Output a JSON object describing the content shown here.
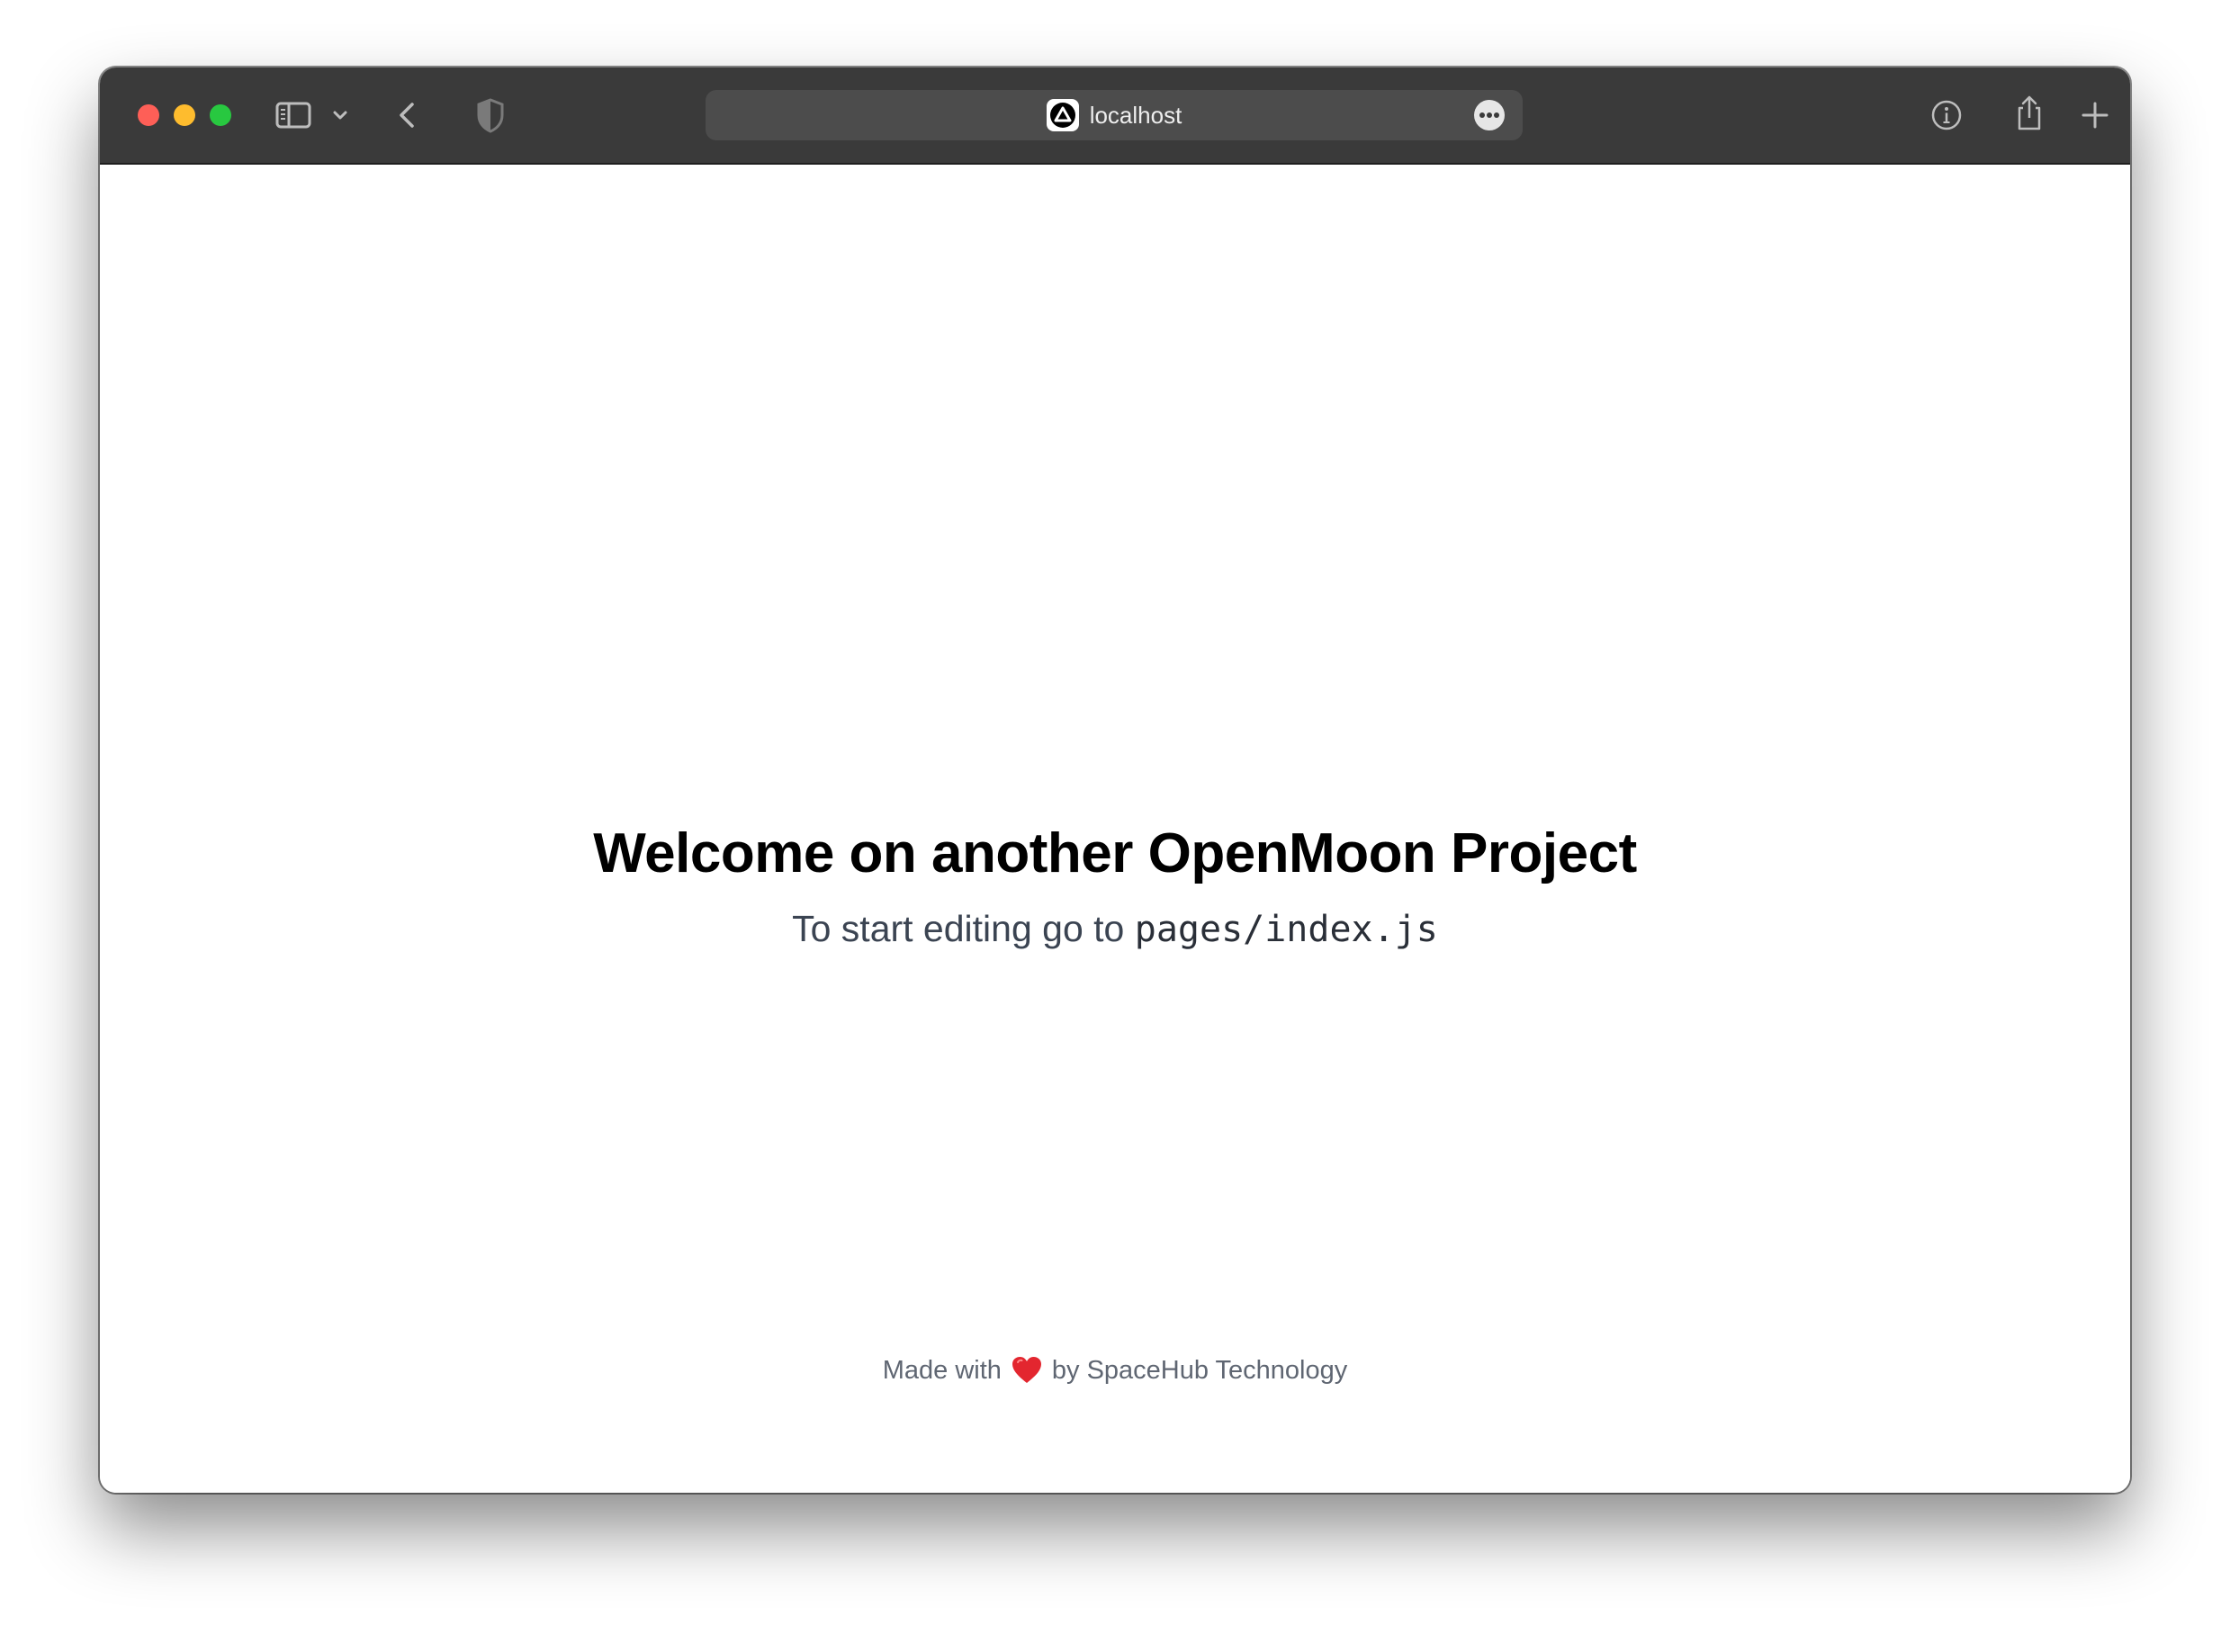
{
  "browser": {
    "url": "localhost",
    "icons": {
      "close": "close-traffic-light",
      "minimize": "minimize-traffic-light",
      "maximize": "maximize-traffic-light",
      "sidebar": "sidebar-icon",
      "sidebar_menu": "chevron-down-icon",
      "back": "chevron-left-icon",
      "privacy": "shield-icon",
      "favicon": "triangle-logo-icon",
      "page_menu": "ellipsis-icon",
      "info": "info-icon",
      "share": "share-icon",
      "new_tab": "plus-icon",
      "tabs": "tabs-overview-icon"
    },
    "colors": {
      "toolbar": "#3a3a3a",
      "close": "#fe5f57",
      "minimize": "#febc2e",
      "maximize": "#28c840"
    }
  },
  "page": {
    "headline": "Welcome on another OpenMoon Project",
    "subline_prefix": "To start editing go to ",
    "subline_code": "pages/index.js",
    "footer_prefix": "Made with",
    "footer_icon": "heart-icon",
    "footer_suffix": "by SpaceHub Technology"
  }
}
